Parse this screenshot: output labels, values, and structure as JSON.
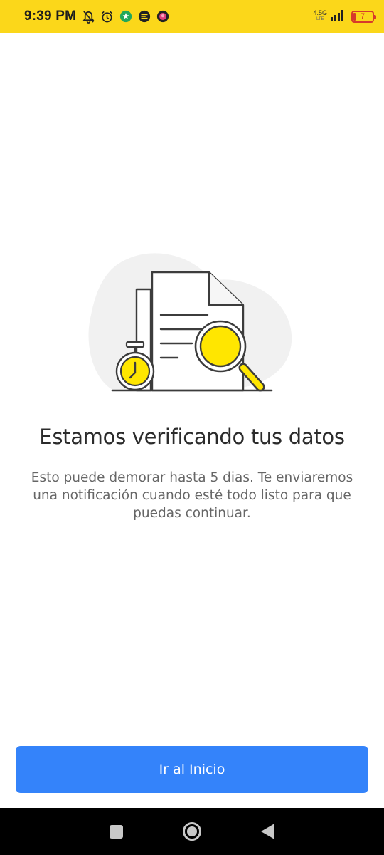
{
  "status_bar": {
    "time": "9:39 PM",
    "network": "4.5G",
    "network_sub": "LTE",
    "battery": "7",
    "icons": [
      "mute-bell-icon",
      "alarm-icon",
      "app-notification-icon",
      "chat-notification-icon",
      "app-badge-icon",
      "signal-icon",
      "battery-icon"
    ]
  },
  "main": {
    "title": "Estamos verificando tus datos",
    "description": "Esto puede demorar hasta 5 dias. Te enviaremos una notificación cuando esté todo listo para que puedas continuar.",
    "illustration": "document-verification-illustration"
  },
  "actions": {
    "primary_label": "Ir al Inicio"
  },
  "colors": {
    "status_bar": "#fbd71a",
    "accent_yellow": "#ffe600",
    "primary_button": "#3483fa",
    "title": "#2b2b2b",
    "description": "#666666"
  }
}
